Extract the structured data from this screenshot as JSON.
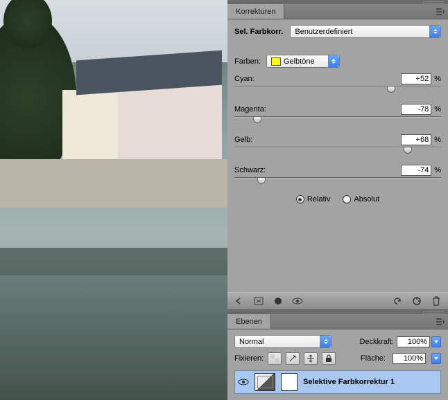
{
  "korrekturen_panel": {
    "tab_title": "Korrekturen",
    "adj_label": "Sel. Farbkorr.",
    "preset": "Benutzerdefiniert",
    "farben_label": "Farben:",
    "farben_value": "Gelbtöne",
    "sliders": {
      "cyan": {
        "label": "Cyan:",
        "value": "+52",
        "pct": "%",
        "pos": 76
      },
      "magenta": {
        "label": "Magenta:",
        "value": "-78",
        "pct": "%",
        "pos": 11
      },
      "gelb": {
        "label": "Gelb:",
        "value": "+68",
        "pct": "%",
        "pos": 84
      },
      "schwarz": {
        "label": "Schwarz:",
        "value": "-74",
        "pct": "%",
        "pos": 13
      }
    },
    "method": {
      "relativ": "Relativ",
      "absolut": "Absolut",
      "selected": "relativ"
    }
  },
  "ebenen_panel": {
    "tab_title": "Ebenen",
    "blend_mode": "Normal",
    "opacity_label": "Deckkraft:",
    "opacity_value": "100%",
    "lock_label": "Fixieren:",
    "fill_label": "Fläche:",
    "fill_value": "100%",
    "layer_name": "Selektive Farbkorrektur 1"
  }
}
